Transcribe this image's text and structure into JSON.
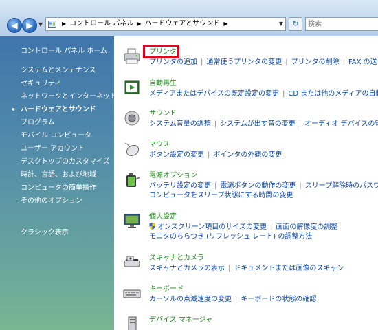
{
  "address_bar": {
    "breadcrumbs": [
      "コントロール パネル",
      "ハードウェアとサウンド"
    ],
    "search_placeholder": "検索"
  },
  "sidebar": {
    "home": "コントロール パネル ホーム",
    "items": [
      "システムとメンテナンス",
      "セキュリティ",
      "ネットワークとインターネット",
      "ハードウェアとサウンド",
      "プログラム",
      "モバイル コンピュータ",
      "ユーザー アカウント",
      "デスクトップのカスタマイズ",
      "時計、言語、および地域",
      "コンピュータの簡単操作",
      "その他のオプション"
    ],
    "active_index": 3,
    "classic": "クラシック表示"
  },
  "categories": [
    {
      "title": "プリンタ",
      "icon": "printer-icon",
      "lines": [
        [
          "プリンタの追加",
          "通常使うプリンタの変更",
          "プリンタの削除",
          "FAX の送"
        ]
      ]
    },
    {
      "title": "自動再生",
      "icon": "autoplay-icon",
      "lines": [
        [
          "メディアまたはデバイスの既定設定の変更",
          "CD または他のメディアの自動"
        ]
      ]
    },
    {
      "title": "サウンド",
      "icon": "speaker-icon",
      "lines": [
        [
          "システム音量の調整",
          "システムが出す音の変更",
          "オーディオ デバイスの管"
        ]
      ]
    },
    {
      "title": "マウス",
      "icon": "mouse-icon",
      "lines": [
        [
          "ボタン設定の変更",
          "ポインタの外観の変更"
        ]
      ]
    },
    {
      "title": "電源オプション",
      "icon": "power-icon",
      "lines": [
        [
          "バッテリ設定の変更",
          "電源ボタンの動作の変更",
          "スリープ解除時のパスワ"
        ],
        [
          "コンピュータをスリープ状態にする時間の変更"
        ]
      ]
    },
    {
      "title": "個人設定",
      "icon": "display-icon",
      "lines": [
        [
          "オンスクリーン項目のサイズの変更",
          "画面の解像度の調整"
        ],
        [
          "モニタのちらつき (リフレッシュ レート) の調整方法"
        ]
      ],
      "shield_line": 0
    },
    {
      "title": "スキャナとカメラ",
      "icon": "scanner-icon",
      "lines": [
        [
          "スキャナとカメラの表示",
          "ドキュメントまたは画像のスキャン"
        ]
      ]
    },
    {
      "title": "キーボード",
      "icon": "keyboard-icon",
      "lines": [
        [
          "カーソルの点滅速度の変更",
          "キーボードの状態の確認"
        ]
      ]
    },
    {
      "title": "デバイス マネージャ",
      "icon": "device-manager-icon",
      "lines": []
    }
  ],
  "colors": {
    "link": "#0b4aa8",
    "category_title": "#188a16",
    "highlight": "#e8001c"
  }
}
